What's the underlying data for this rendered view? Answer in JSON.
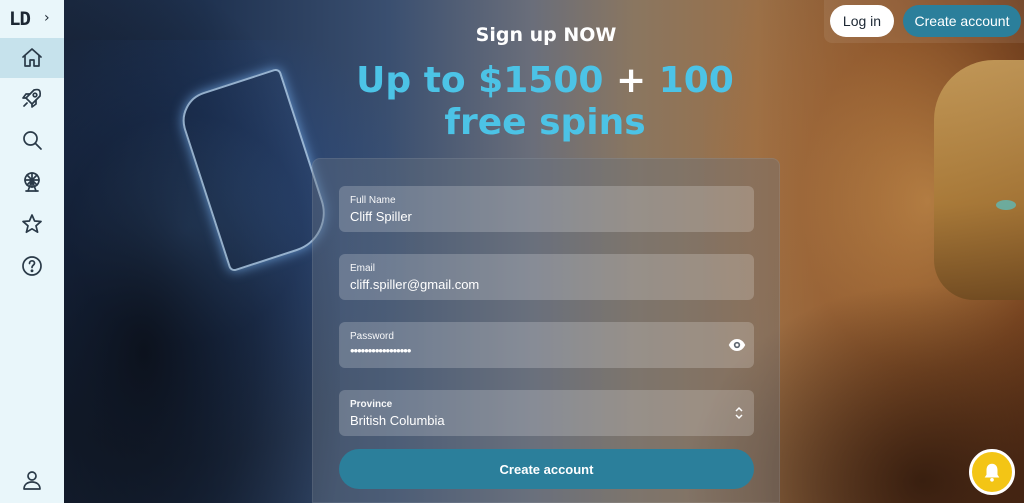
{
  "app": {
    "logo": "LD",
    "expand_icon": "chevron-right-icon"
  },
  "sidebar": {
    "items": [
      {
        "name": "home",
        "icon": "home-icon",
        "active": true
      },
      {
        "name": "rocket",
        "icon": "rocket-icon",
        "active": false
      },
      {
        "name": "search",
        "icon": "search-icon",
        "active": false
      },
      {
        "name": "ferris-wheel",
        "icon": "ferris-wheel-icon",
        "active": false
      },
      {
        "name": "favorites",
        "icon": "star-icon",
        "active": false
      },
      {
        "name": "help",
        "icon": "help-icon",
        "active": false
      }
    ],
    "bottom_item": {
      "name": "profile",
      "icon": "user-icon"
    }
  },
  "header": {
    "login_label": "Log in",
    "create_account_label": "Create account"
  },
  "signup": {
    "title": "Sign up NOW",
    "promo_line1_amount": "Up to $1500",
    "promo_plus": "+",
    "promo_line1_spins": "100",
    "promo_line2": "free spins"
  },
  "form": {
    "full_name": {
      "label": "Full Name",
      "value": "Cliff Spiller"
    },
    "email": {
      "label": "Email",
      "value": "cliff.spiller@gmail.com"
    },
    "password": {
      "label": "Password",
      "masked_value": "•••••••••••••••••",
      "icon": "eye-icon"
    },
    "province": {
      "label": "Province",
      "value": "British Columbia",
      "icon": "chevron-updown-icon"
    },
    "submit_label": "Create account"
  },
  "notifications": {
    "icon": "bell-icon"
  },
  "colors": {
    "accent": "#2b7f9b",
    "promo": "#4cc3e6",
    "sidebar_bg": "#e9f6fa",
    "bell": "#f3c515"
  }
}
